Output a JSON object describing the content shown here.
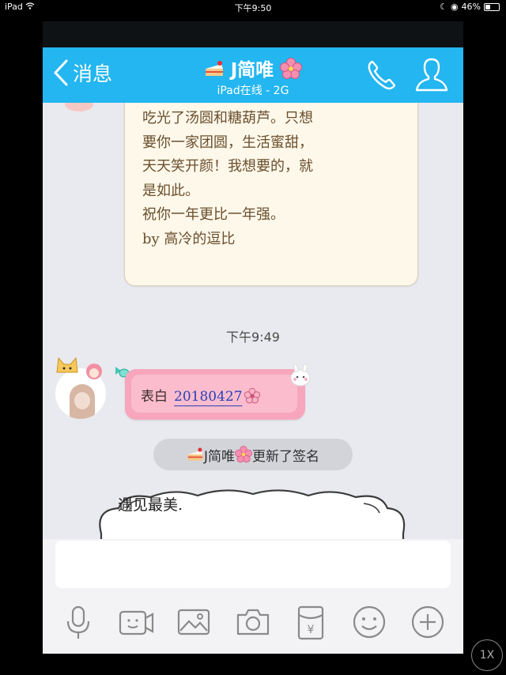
{
  "status_bar": {
    "device": "iPad",
    "time": "下午9:50",
    "battery": "46%",
    "battery_level": 0.46
  },
  "nav": {
    "back_label": "消息",
    "title_name": "J简唯",
    "subtitle": "iPad在线 - 2G"
  },
  "letter": {
    "lines": [
      "吃光了汤圆和糖葫芦。只想",
      "要你一家团圆，生活蜜甜，",
      "天天笑开颜！我想要的，就",
      "是如此。",
      "祝你一年更比一年强。",
      "by 高冷的逗比"
    ]
  },
  "timestamp": "下午9:49",
  "pink_message": {
    "prefix": "表白",
    "link_text": "20180427"
  },
  "system_notice": {
    "name": "J简唯",
    "suffix": "更新了签名"
  },
  "signature_card": {
    "text": "遇见最美."
  },
  "overlay_button": "1X",
  "colors": {
    "nav_blue": "#23b6f0",
    "chat_bg": "#e9eaef",
    "bubble_pink": "#f7a6bd"
  },
  "icons": [
    "back-chevron-icon",
    "cake-icon",
    "sakura-icon",
    "phone-icon",
    "profile-icon",
    "voice-icon",
    "video-icon",
    "image-icon",
    "camera-icon",
    "red-packet-icon",
    "emoji-icon",
    "plus-icon"
  ]
}
